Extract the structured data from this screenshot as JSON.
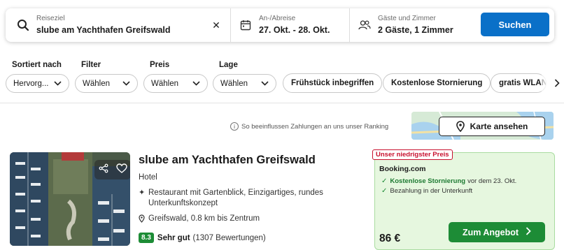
{
  "search": {
    "destination_label": "Reiseziel",
    "destination_value": "slube am Yachthafen Greifswald",
    "dates_label": "An-/Abreise",
    "dates_value": "27. Okt. - 28. Okt.",
    "guests_label": "Gäste und Zimmer",
    "guests_value": "2 Gäste, 1 Zimmer",
    "clear_symbol": "✕",
    "search_button": "Suchen"
  },
  "filters": {
    "sort": {
      "label": "Sortiert nach",
      "value": "Hervorg..."
    },
    "filter": {
      "label": "Filter",
      "value": "Wählen"
    },
    "price": {
      "label": "Preis",
      "value": "Wählen"
    },
    "location": {
      "label": "Lage",
      "value": "Wählen"
    },
    "chips": [
      "Frühstück inbegriffen",
      "Kostenlose Stornierung",
      "gratis WLAN"
    ]
  },
  "ranking_info": "So beeinflussen Zahlungen an uns unser Ranking",
  "map_button": "Karte ansehen",
  "hotel": {
    "name": "slube am Yachthafen Greifswald",
    "type": "Hotel",
    "feature": "Restaurant mit Gartenblick, Einzigartiges, rundes Unterkunftskonzept",
    "location": "Greifswald, 0.8 km bis Zentrum",
    "score": "8.3",
    "rating_word": "Sehr gut",
    "reviews": "(1307 Bewertungen)"
  },
  "offer": {
    "badge": "Unser niedrigster Preis",
    "provider": "Booking.com",
    "perk1_bold": "Kostenlose Stornierung",
    "perk1_rest": "vor dem 23. Okt.",
    "perk2": "Bezahlung in der Unterkunft",
    "price": "86 €",
    "button": "Zum Angebot"
  },
  "colors": {
    "primary_blue": "#0a70c8",
    "deal_green": "#1d8c36",
    "offer_bg": "#e6f7df",
    "badge_red": "#c8102e"
  },
  "icons": {
    "destination": "search-icon",
    "dates": "calendar-icon",
    "guests": "guests-icon",
    "map": "map-pin-icon",
    "feature": "sparkle-icon",
    "location": "location-pin-icon",
    "share": "share-icon",
    "favorite": "heart-icon"
  }
}
